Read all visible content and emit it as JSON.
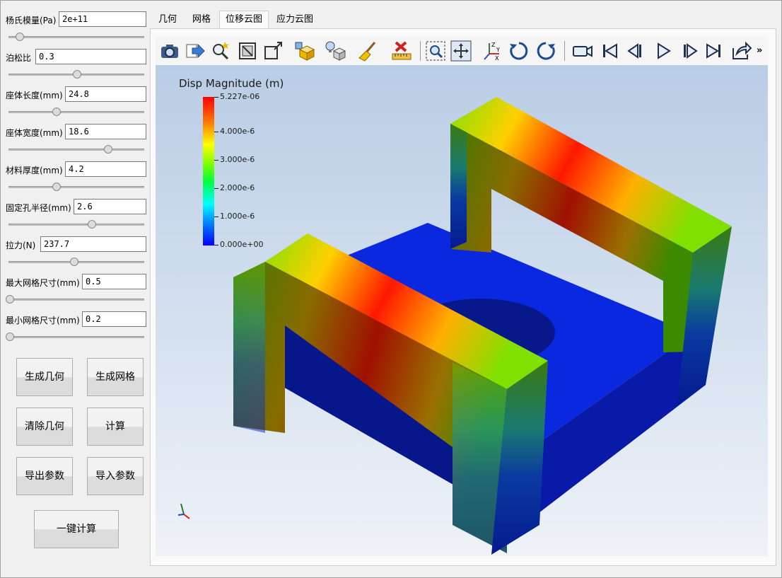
{
  "params": [
    {
      "label": "杨氏模量(Pa)",
      "value": "2e+11",
      "slider": 0.08
    },
    {
      "label": "泊松比",
      "value": "0.3",
      "slider": 0.5
    },
    {
      "label": "座体长度(mm)",
      "value": "24.8",
      "slider": 0.35
    },
    {
      "label": "座体宽度(mm)",
      "value": "18.6",
      "slider": 0.73
    },
    {
      "label": "材料厚度(mm)",
      "value": "4.2",
      "slider": 0.35
    },
    {
      "label": "固定孔半径(mm)",
      "value": "2.6",
      "slider": 0.61
    },
    {
      "label": "拉力(N)",
      "value": "237.7",
      "slider": 0.48
    },
    {
      "label": "最大网格尺寸(mm)",
      "value": "0.5",
      "slider": 0.0
    },
    {
      "label": "最小网格尺寸(mm)",
      "value": "0.2",
      "slider": 0.0
    }
  ],
  "buttons": {
    "gen_geometry": "生成几何",
    "gen_mesh": "生成网格",
    "clear_geometry": "清除几何",
    "compute": "计算",
    "export_params": "导出参数",
    "import_params": "导入参数",
    "one_click": "一键计算"
  },
  "tabs": [
    "几何",
    "网格",
    "位移云图",
    "应力云图"
  ],
  "active_tab": "位移云图",
  "toolbar_icons": [
    "camera-icon",
    "export-arrow-icon",
    "zoom-magic-icon",
    "view-fit-icon",
    "view-box-icon",
    "cube-select-icon",
    "light-bulb-icon",
    "broom-icon",
    "ruler-clear-icon",
    "zoom-box-icon",
    "pan-icon",
    "axes-icon",
    "rotate-cw-icon",
    "rotate-ccw-icon",
    "video-camera-icon",
    "first-frame-icon",
    "prev-frame-icon",
    "play-icon",
    "next-frame-icon",
    "last-frame-icon",
    "share-icon"
  ],
  "more_label": "»",
  "legend": {
    "title": "Disp Magnitude (m)",
    "ticks": [
      "5.227e-06",
      "4.000e-6",
      "3.000e-6",
      "2.000e-6",
      "1.000e-6",
      "0.000e+00"
    ]
  },
  "colors": {
    "accent_red": "#ff0000",
    "accent_blue": "#0000ff"
  }
}
